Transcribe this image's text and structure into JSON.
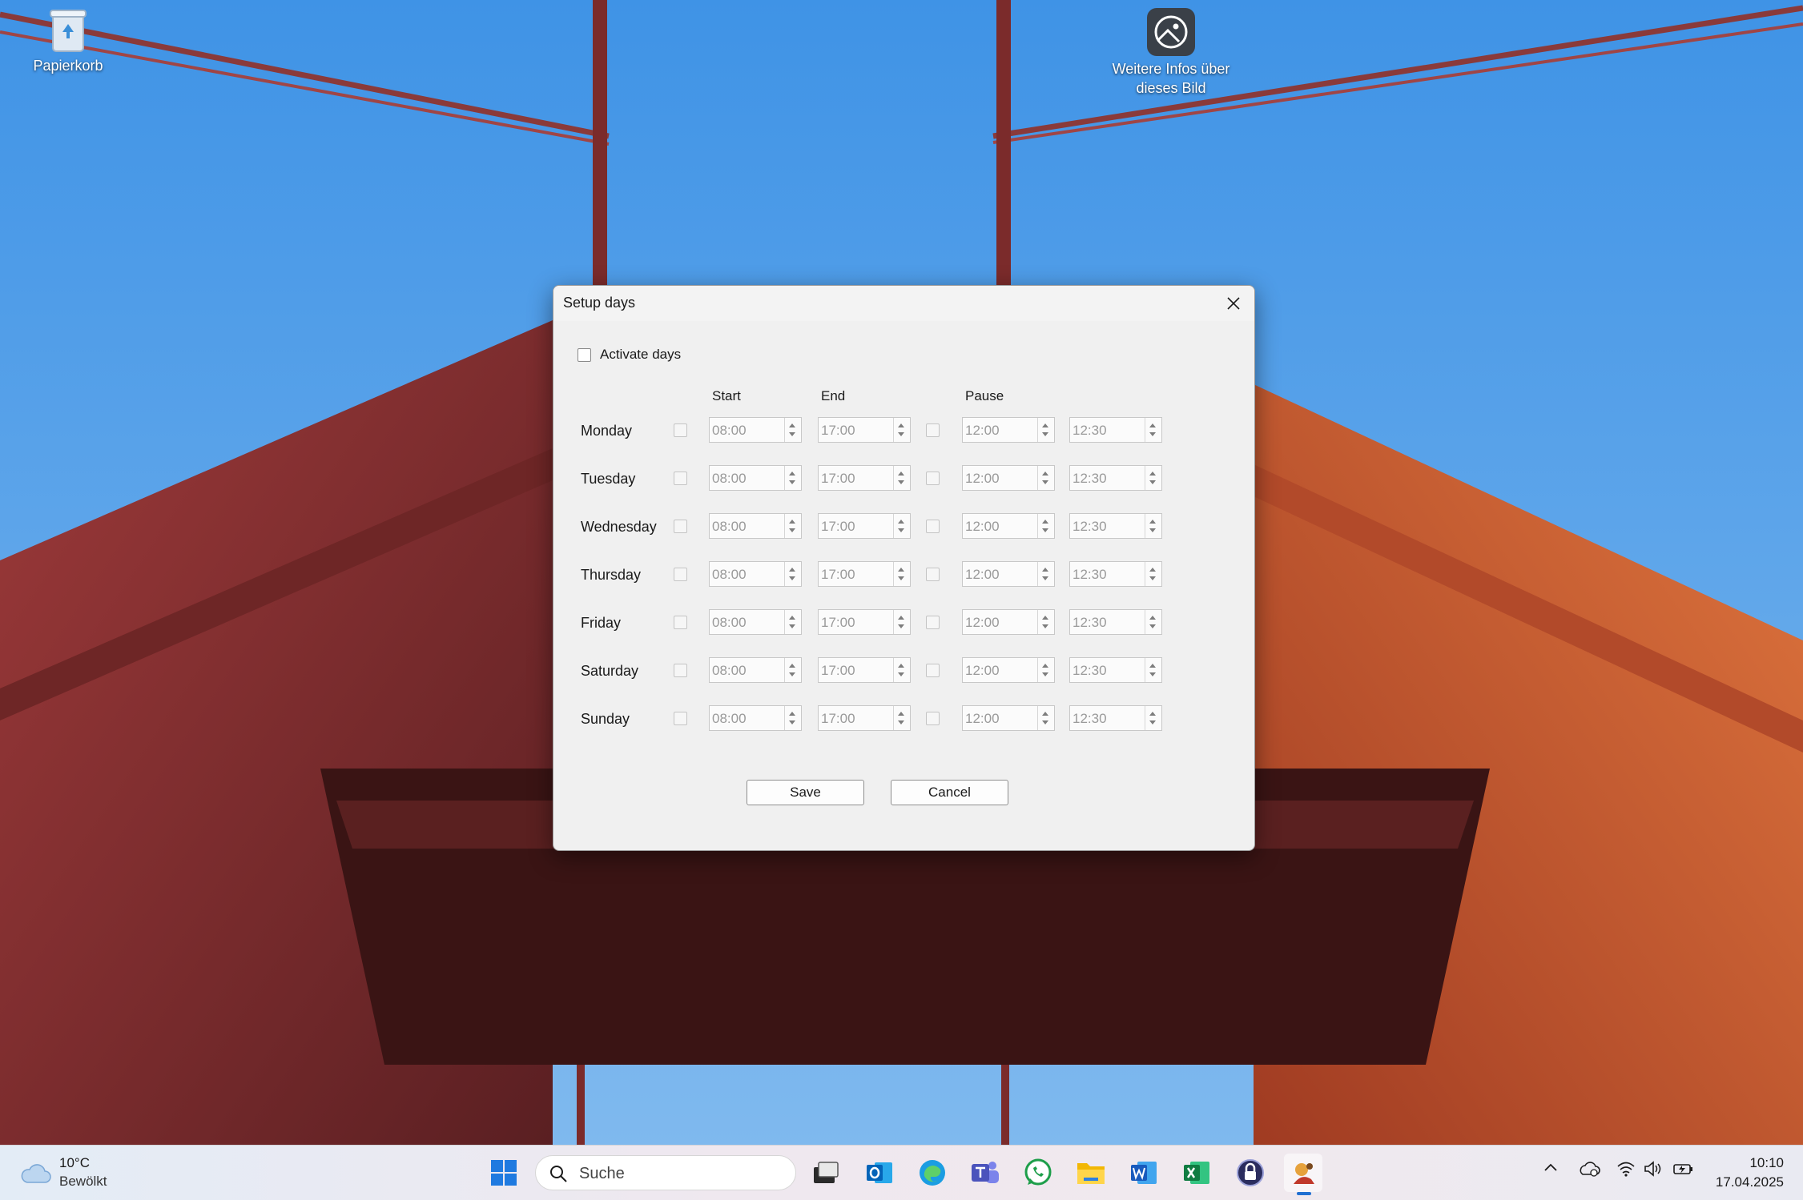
{
  "desktop": {
    "icons": [
      {
        "label": "Papierkorb"
      },
      {
        "label_line1": "Weitere Infos über",
        "label_line2": "dieses Bild"
      }
    ]
  },
  "dialog": {
    "title": "Setup days",
    "activate_label": "Activate days",
    "activate_checked": false,
    "columns": {
      "start": "Start",
      "end": "End",
      "pause": "Pause"
    },
    "days": [
      {
        "name": "Monday",
        "start": "08:00",
        "end": "17:00",
        "pause_from": "12:00",
        "pause_to": "12:30"
      },
      {
        "name": "Tuesday",
        "start": "08:00",
        "end": "17:00",
        "pause_from": "12:00",
        "pause_to": "12:30"
      },
      {
        "name": "Wednesday",
        "start": "08:00",
        "end": "17:00",
        "pause_from": "12:00",
        "pause_to": "12:30"
      },
      {
        "name": "Thursday",
        "start": "08:00",
        "end": "17:00",
        "pause_from": "12:00",
        "pause_to": "12:30"
      },
      {
        "name": "Friday",
        "start": "08:00",
        "end": "17:00",
        "pause_from": "12:00",
        "pause_to": "12:30"
      },
      {
        "name": "Saturday",
        "start": "08:00",
        "end": "17:00",
        "pause_from": "12:00",
        "pause_to": "12:30"
      },
      {
        "name": "Sunday",
        "start": "08:00",
        "end": "17:00",
        "pause_from": "12:00",
        "pause_to": "12:30"
      }
    ],
    "save_label": "Save",
    "cancel_label": "Cancel"
  },
  "taskbar": {
    "weather_temp": "10°C",
    "weather_desc": "Bewölkt",
    "search_placeholder": "Suche",
    "apps": [
      "start-icon",
      "task-view-icon",
      "outlook-icon",
      "edge-icon",
      "teams-icon",
      "whatsapp-icon",
      "file-explorer-icon",
      "word-icon",
      "excel-icon",
      "keepass-icon",
      "active-app-icon"
    ],
    "time": "10:10",
    "date": "17.04.2025"
  }
}
